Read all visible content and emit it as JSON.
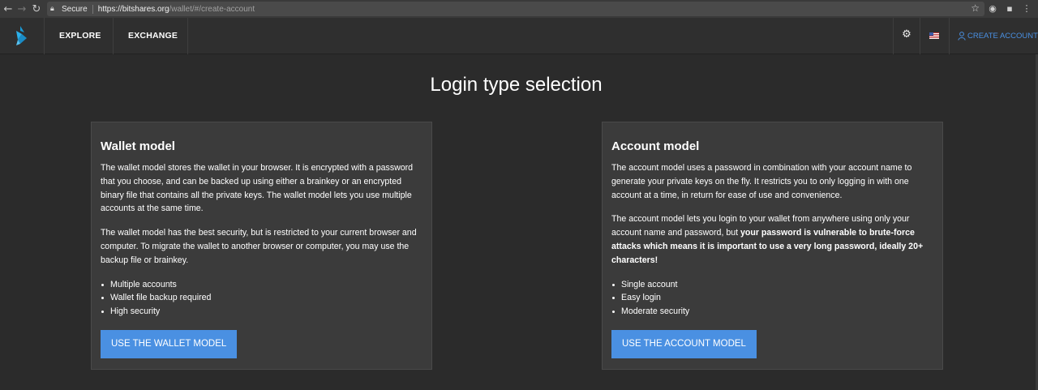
{
  "browser": {
    "back_icon": "arrow-left-icon",
    "forward_icon": "arrow-right-icon",
    "reload_icon": "reload-icon",
    "secure_label": "Secure",
    "url_host": "https://bitshares.org",
    "url_path": "/wallet/#/create-account",
    "bookmark_icon": "star-icon"
  },
  "header": {
    "nav": [
      "EXPLORE",
      "EXCHANGE"
    ],
    "create_account": "CREATE ACCOUNT",
    "accent": "#4a90e2"
  },
  "main": {
    "title": "Login type selection",
    "wallet": {
      "title": "Wallet model",
      "p1": "The wallet model stores the wallet in your browser. It is encrypted with a password that you choose, and can be backed up using either a brainkey or an encrypted binary file that contains all the private keys. The wallet model lets you use multiple accounts at the same time.",
      "p2": "The wallet model has the best security, but is restricted to your current browser and computer. To migrate the wallet to another browser or computer, you may use the backup file or brainkey.",
      "features": [
        "Multiple accounts",
        "Wallet file backup required",
        "High security"
      ],
      "button": "USE THE WALLET MODEL"
    },
    "account": {
      "title": "Account model",
      "p1": "The account model uses a password in combination with your account name to generate your private keys on the fly. It restricts you to only logging in with one account at a time, in return for ease of use and convenience.",
      "p2_lead": "The account model lets you login to your wallet from anywhere using only your account name and password, but ",
      "p2_bold": "your password is vulnerable to brute-force attacks which means it is important to use a very long password, ideally 20+ characters!",
      "features": [
        "Single account",
        "Easy login",
        "Moderate security"
      ],
      "button": "USE THE ACCOUNT MODEL"
    }
  }
}
